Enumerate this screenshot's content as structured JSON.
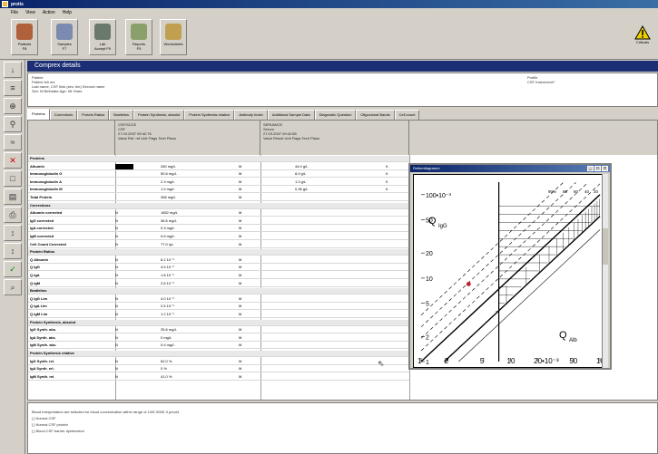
{
  "window": {
    "title": "protis"
  },
  "menu": [
    "File",
    "View",
    "Action",
    "Help"
  ],
  "toolbar": [
    {
      "label1": "Patients",
      "label2": "F8",
      "icon": "patients-icon",
      "color": "#b0603a"
    },
    {
      "label1": "Samples",
      "label2": "F7",
      "icon": "samples-icon",
      "color": "#7a8ab0"
    },
    {
      "label1": "Lab",
      "label2": "Accept F9",
      "icon": "lab-accept-icon",
      "color": "#6a7a6a"
    },
    {
      "label1": "Reports",
      "label2": "F5",
      "icon": "reports-icon",
      "color": "#8aa06a"
    },
    {
      "label1": "Worksheets",
      "label2": "",
      "icon": "worksheets-icon",
      "color": "#c0a050"
    }
  ],
  "warning": {
    "label": "Criticals",
    "icon": "warning-icon"
  },
  "left_buttons": [
    "↓",
    "≡",
    "⊕",
    "⚲",
    "≈",
    "✕",
    "□",
    "▤",
    "⎙",
    "↕",
    "↕",
    "✓",
    "⌕"
  ],
  "section": {
    "title": "Comprex details"
  },
  "patient": {
    "heading": "Patient",
    "lines": [
      "Patient full res",
      "Last name, CSF Ilink (sim, bin)   Second name",
      "Sex: M  Birthdate        Age: 98 Years"
    ],
    "profile_heading": "Profile",
    "profile_value": "CSF Instrument?"
  },
  "tabs": [
    "Proteins",
    "Corrections",
    "Protein Ratios",
    "Bratfelins",
    "Protein Synthesis, absolut",
    "Protein Synthesis relative",
    "Antibody Index",
    "Additional Sample Data",
    "Diagnostic Question",
    "Oligoclonal Bands",
    "Cell count"
  ],
  "grid": {
    "col1_header": [
      "CSF/SCCE",
      "CSF",
      "27.03.2007 09:42:76",
      "Value         Ref. ref  Unit        Flags  Tech  Plaus"
    ],
    "col2_header": [
      "SERUM/CE",
      "Serum",
      "27.03.2007 09:42:85",
      "Value         Result   Unit        Flags  Tech  Plaus"
    ],
    "rows": [
      {
        "group": true,
        "name": "Proteins"
      },
      {
        "name": "Albumin",
        "flag": "big",
        "v1": "280  mg/L",
        "s1": "M",
        "v2": "44.0  g/L",
        "s2": "K"
      },
      {
        "name": "Immunoglobulin G",
        "v1": "50.6  mg/L",
        "s1": "M",
        "v2": "8.9  g/L",
        "s2": "K"
      },
      {
        "name": "Immunoglobulin A",
        "v1": "2.3  mg/L",
        "s1": "M",
        "v2": "1.3  g/L",
        "s2": "K"
      },
      {
        "name": "Immunoglobulin M",
        "v1": "1.0  mg/L",
        "s1": "M",
        "v2": "0.36  g/L",
        "s2": "K"
      },
      {
        "name": "Total Protein",
        "v1": "396  mg/L",
        "s1": "M"
      },
      {
        "group": true,
        "name": "Corrections"
      },
      {
        "name": "Albumin corrected",
        "flag": "N",
        "v1": "1852  mg/L",
        "s1": "M"
      },
      {
        "name": "IgG corrected",
        "flag": "N",
        "v1": "36.6  mg/L",
        "s1": "M"
      },
      {
        "name": "IgA corrected",
        "flag": "N",
        "v1": "0.3  mg/L",
        "s1": "M"
      },
      {
        "name": "IgM corrected",
        "flag": "N",
        "v1": "0.6  mg/L",
        "s1": "M"
      },
      {
        "name": "Cell Count Corrected",
        "flag": "N",
        "v1": "77.0  /µL",
        "s1": "M"
      },
      {
        "group": true,
        "name": "Protein Ratios"
      },
      {
        "name": "Q Albumin",
        "flag": "N",
        "v1": "6.2  10⁻³",
        "s1": "M"
      },
      {
        "name": "Q IgG",
        "flag": "N",
        "v1": "4.5  10⁻³",
        "s1": "M"
      },
      {
        "name": "Q IgA",
        "flag": "N",
        "v1": "1.8  10⁻³",
        "s1": "M"
      },
      {
        "name": "Q IgM",
        "flag": "N",
        "v1": "2.8  10⁻³",
        "s1": "M"
      },
      {
        "group": true,
        "name": "Bratfelins"
      },
      {
        "name": "Q IgG Lim",
        "flag": "N",
        "v1": "4.0  10⁻³",
        "s1": "M"
      },
      {
        "name": "Q IgA Lim",
        "flag": "N",
        "v1": "2.5  10⁻³",
        "s1": "M"
      },
      {
        "name": "Q IgM Lim",
        "flag": "N",
        "v1": "1.2  10⁻³",
        "s1": "M"
      },
      {
        "group": true,
        "name": "Protein Synthesis, absolut"
      },
      {
        "name": "IgG Synth. abs.",
        "flag": "N",
        "v1": "35.6  mg/L",
        "s1": "M"
      },
      {
        "name": "IgA Synth. abs.",
        "flag": "N",
        "v1": "0  mg/L",
        "s1": "M"
      },
      {
        "name": "IgM Synth. abs.",
        "flag": "N",
        "v1": "0.4  mg/L",
        "s1": "M"
      },
      {
        "group": true,
        "name": "Protein Synthesis relative"
      },
      {
        "name": "IgG Synth. rel.",
        "flag": "N",
        "v1": "62.0  %",
        "s1": "M"
      },
      {
        "name": "IgA Synth. rel.",
        "flag": "N",
        "v1": "0  %",
        "s1": "M"
      },
      {
        "name": "IgM Synth. rel.",
        "flag": "N",
        "v1": "41.0  %",
        "s1": "M"
      }
    ]
  },
  "notes": {
    "lines": [
      "Blood interpretation are selected for blood concentration within range of 10/E.000E-3 μmol/L",
      "[ ]  Normal CSF",
      "[ ]  Normal CSF protein",
      "[ ]  Blood CSF barrier dysfunction"
    ]
  },
  "popup": {
    "title": "Reiberdiagramm",
    "ylabel": "Q",
    "ysub": "IgG",
    "xlabel": "Q",
    "xsub": "Alb",
    "yticks": [
      "100•10⁻³",
      "50",
      "20",
      "10",
      "5",
      "2",
      "1"
    ],
    "xticks": [
      "1",
      "2",
      "5",
      "10",
      "20•10⁻³",
      "50",
      "100"
    ],
    "pct": [
      "90%",
      "80",
      "60",
      "40",
      "20"
    ],
    "ytickvals": [
      100,
      50,
      20,
      10,
      5,
      2,
      1
    ],
    "xtickvals": [
      1,
      2,
      5,
      10,
      20,
      50,
      100
    ],
    "point": {
      "qalb": 3.4,
      "qigg": 8.5,
      "color": "#c0202a"
    }
  }
}
